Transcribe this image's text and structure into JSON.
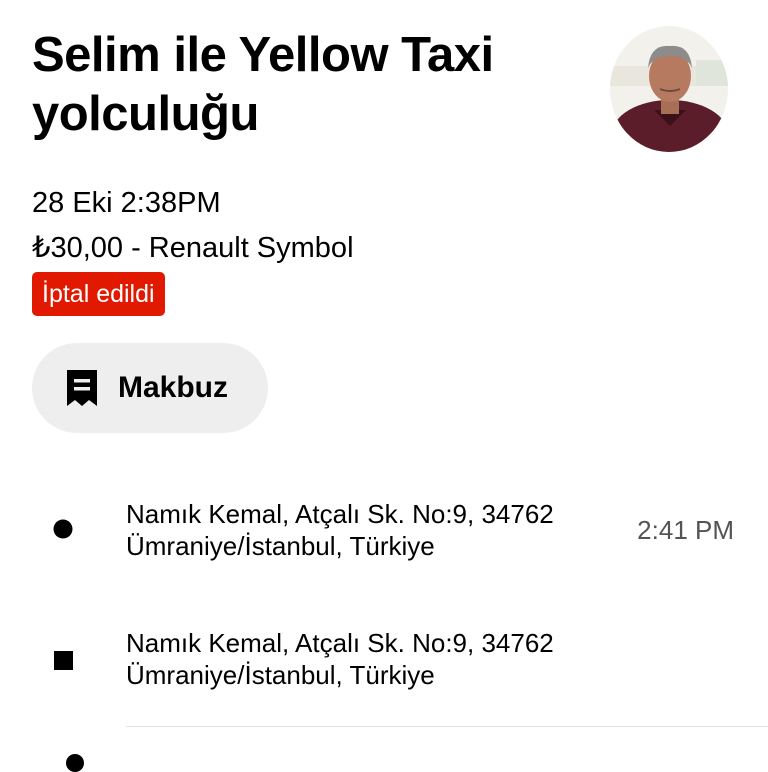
{
  "trip": {
    "title": "Selim ile Yellow Taxi yolculuğu",
    "date_time": "28 Eki 2:38PM",
    "price_vehicle": "₺30,00 - Renault Symbol",
    "status": "İptal edildi",
    "status_color": "#e11900"
  },
  "receipt_button": {
    "label": "Makbuz",
    "icon": "receipt-icon"
  },
  "stops": [
    {
      "address_line1": "Namık Kemal, Atçalı Sk. No:9, 34762",
      "address_line2": "Ümraniye/İstanbul, Türkiye",
      "time": "2:41 PM",
      "icon": "circle-dot-icon"
    },
    {
      "address_line1": "Namık Kemal, Atçalı Sk. No:9, 34762",
      "address_line2": "Ümraniye/İstanbul, Türkiye",
      "time": "",
      "icon": "square-stop-icon"
    }
  ]
}
